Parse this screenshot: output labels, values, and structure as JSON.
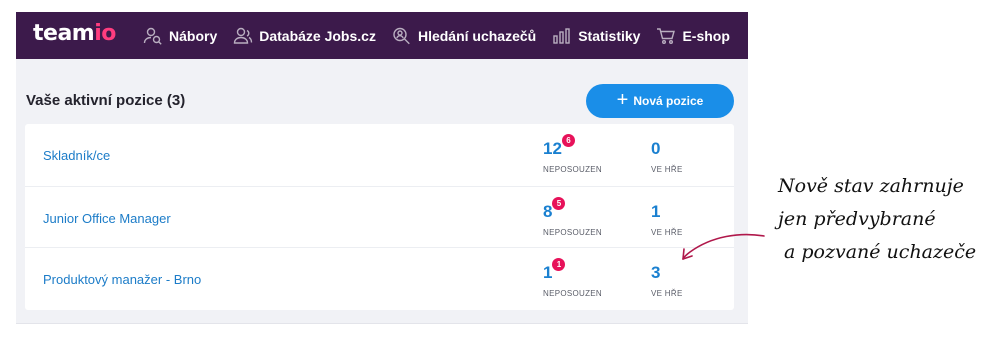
{
  "navbar": {
    "logo_part1": "team",
    "logo_part2": "io",
    "items": [
      {
        "label": "Nábory",
        "icon": "users-search-icon"
      },
      {
        "label": "Databáze Jobs.cz",
        "icon": "database-people-icon"
      },
      {
        "label": "Hledání uchazečů",
        "icon": "magnifier-person-icon"
      },
      {
        "label": "Statistiky",
        "icon": "bar-chart-icon"
      },
      {
        "label": "E-shop",
        "icon": "cart-icon"
      }
    ],
    "colors": {
      "background": "#3c1a4b",
      "logo_accent": "#ff3d7f"
    }
  },
  "main": {
    "title": "Vaše aktivní pozice (3)",
    "new_button": "Nová pozice",
    "new_button_color": "#1a8ee8",
    "positions": [
      {
        "name": "Skladník/ce",
        "unreviewed": "12",
        "badge": "6",
        "unreviewed_label": "NEPOSOUZEN",
        "in_play": "0",
        "in_play_label": "VE HŘE"
      },
      {
        "name": "Junior Office Manager",
        "unreviewed": "8",
        "badge": "5",
        "unreviewed_label": "NEPOSOUZEN",
        "in_play": "1",
        "in_play_label": "VE HŘE"
      },
      {
        "name": "Produktový manažer - Brno",
        "unreviewed": "1",
        "badge": "1",
        "unreviewed_label": "NEPOSOUZEN",
        "in_play": "3",
        "in_play_label": "VE HŘE"
      }
    ],
    "badge_color": "#e7125a"
  },
  "annotation": {
    "lines": [
      "Nově stav zahrnuje",
      "jen předvybrané",
      "a pozvané uchazeče"
    ],
    "color": "#b0184b"
  }
}
